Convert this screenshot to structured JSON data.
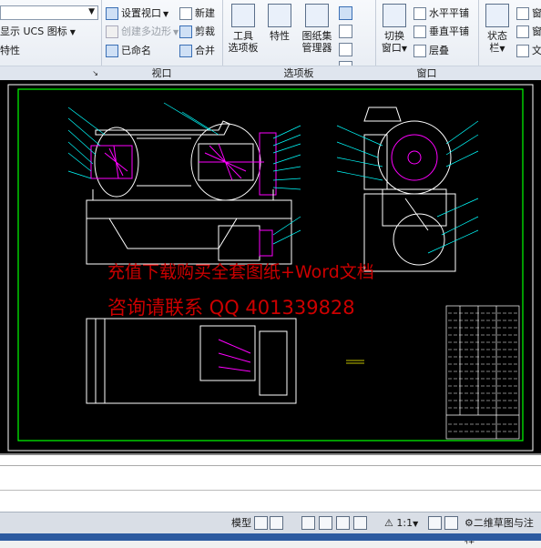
{
  "ribbon": {
    "panel_ucs": {
      "show_ucs_icon": "显示 UCS 图标",
      "properties": "特性"
    },
    "panel_viewport": {
      "title": "视口",
      "set_viewport": "设置视口",
      "create_polygonal": "创建多边形",
      "named": "已命名",
      "new": "新建",
      "clip": "剪裁",
      "join": "合并"
    },
    "panel_palettes": {
      "title": "选项板",
      "tool_palettes_1": "工具",
      "tool_palettes_2": "选项板",
      "properties": "特性",
      "sheet_set_1": "图纸集",
      "sheet_set_2": "管理器"
    },
    "panel_window": {
      "title": "窗口",
      "switch_1": "切换",
      "switch_2": "窗口",
      "tile_horizontal": "水平平铺",
      "tile_vertical": "垂直平铺",
      "cascade": "层叠"
    },
    "panel_status": {
      "status_1": "状态",
      "status_2": "栏",
      "right_1": "窗",
      "right_2": "文"
    }
  },
  "watermark": {
    "line1": "充值下载购买全套图纸+Word文档",
    "line2": "咨询请联系 QQ 401339828"
  },
  "status_bar": {
    "model_tab": "模型",
    "annotation_scale": "1:1",
    "workspace": "二维草图与注释"
  },
  "colors": {
    "cad_background": "#000000",
    "drawing_frame": "#00ff00",
    "watermark": "#cc0000",
    "ribbon": "#e6ebf2"
  }
}
